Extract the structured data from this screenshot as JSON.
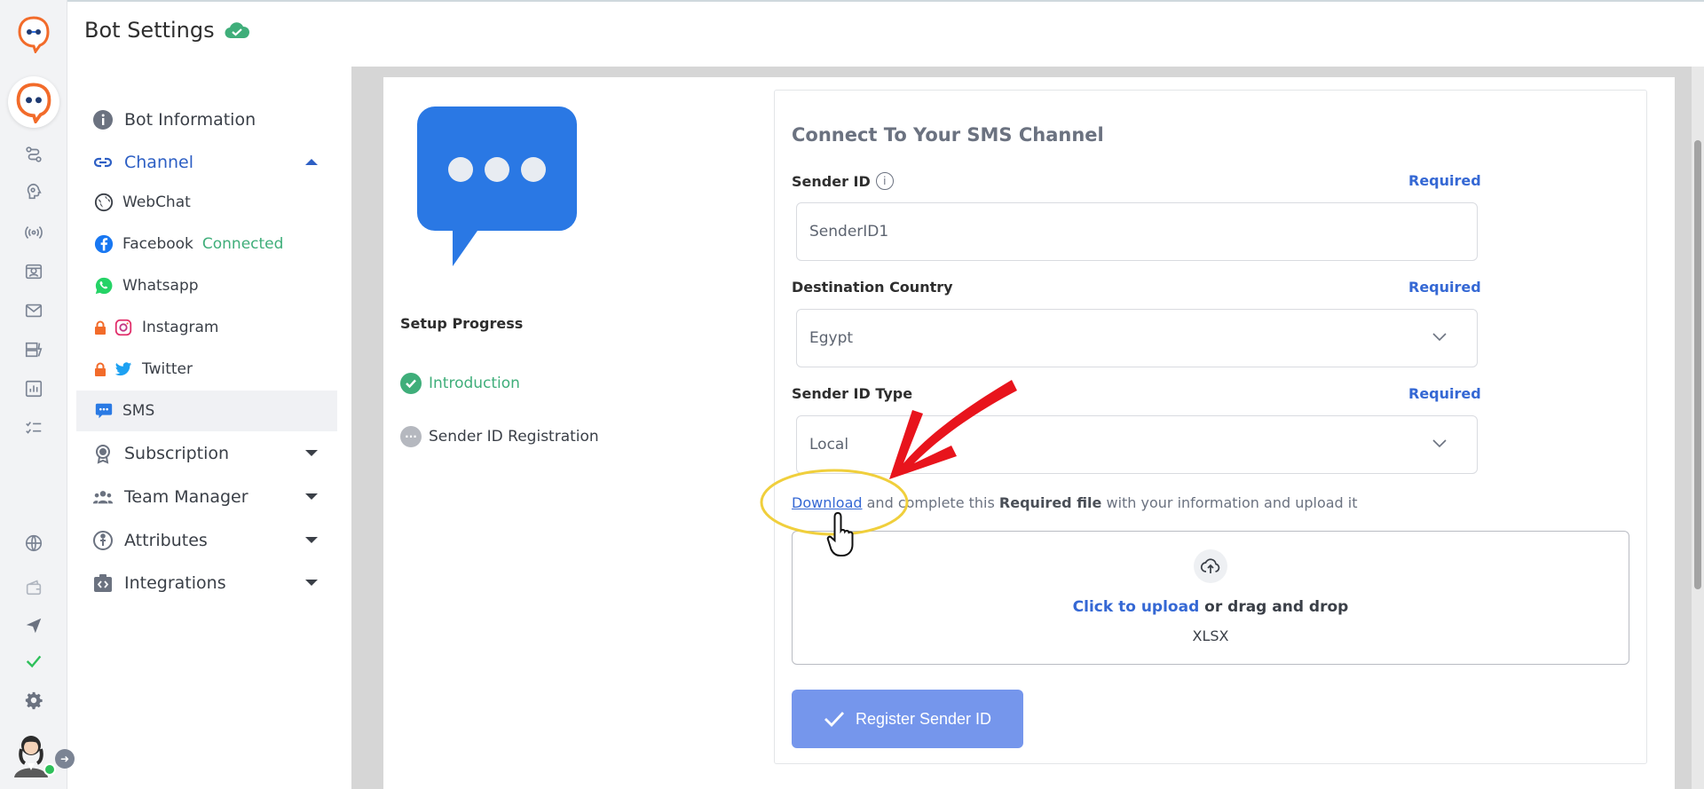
{
  "header": {
    "title": "Bot Settings"
  },
  "nav": {
    "items": [
      {
        "label": "Bot Information"
      },
      {
        "label": "Channel"
      },
      {
        "label": "Subscription"
      },
      {
        "label": "Team Manager"
      },
      {
        "label": "Attributes"
      },
      {
        "label": "Integrations"
      }
    ],
    "channels": [
      {
        "label": "WebChat"
      },
      {
        "label": "Facebook",
        "status": "Connected"
      },
      {
        "label": "Whatsapp"
      },
      {
        "label": "Instagram"
      },
      {
        "label": "Twitter"
      },
      {
        "label": "SMS"
      }
    ]
  },
  "setup": {
    "title": "Setup Progress",
    "steps": [
      {
        "label": "Introduction",
        "state": "done"
      },
      {
        "label": "Sender ID Registration",
        "state": "pending"
      }
    ]
  },
  "form": {
    "title": "Connect To Your SMS Channel",
    "required_label": "Required",
    "sender_id": {
      "label": "Sender ID",
      "value": "SenderID1"
    },
    "destination_country": {
      "label": "Destination Country",
      "value": "Egypt"
    },
    "sender_id_type": {
      "label": "Sender ID Type",
      "value": "Local"
    },
    "download": {
      "link": "Download",
      "text_1": "and complete this",
      "bold": "Required file",
      "text_2": "with your information and upload it"
    },
    "upload": {
      "link": "Click to upload",
      "text": "or drag and drop",
      "formats": "XLSX"
    },
    "submit_label": "Register Sender ID"
  },
  "colors": {
    "accent": "#3568d4",
    "success": "#3fae7a",
    "button": "#7596ec",
    "annotation_arrow": "#e8141c",
    "annotation_circle": "#f0cf3c"
  }
}
